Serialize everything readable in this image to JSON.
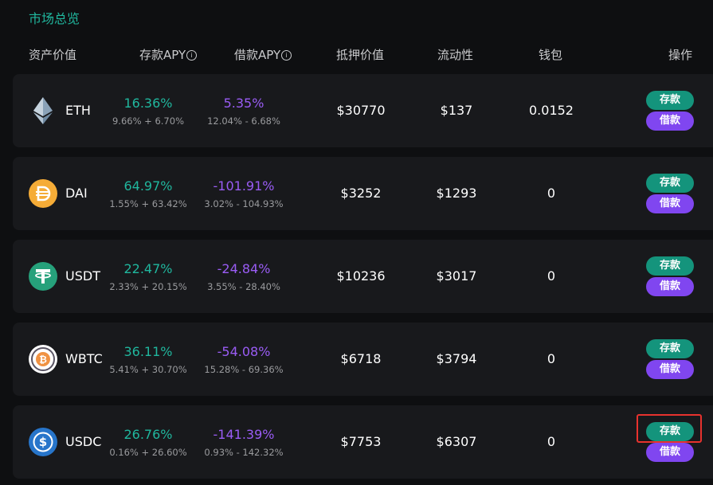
{
  "title": "市场总览",
  "headers": {
    "asset_value": "资产价值",
    "supply_apy": "存款APY",
    "borrow_apy": "借款APY",
    "collateral_value": "抵押价值",
    "liquidity": "流动性",
    "wallet": "钱包",
    "actions": "操作"
  },
  "info_glyph": "i",
  "rows": [
    {
      "name": "ETH",
      "icon": "eth-icon",
      "supply_apy": "16.36%",
      "supply_detail": "9.66% + 6.70%",
      "borrow_apy": "5.35%",
      "borrow_detail": "12.04% - 6.68%",
      "collateral": "$30770",
      "liquidity": "$137",
      "wallet": "0.0152",
      "deposit_label": "存款",
      "borrow_label": "借款"
    },
    {
      "name": "DAI",
      "icon": "dai-icon",
      "supply_apy": "64.97%",
      "supply_detail": "1.55% + 63.42%",
      "borrow_apy": "-101.91%",
      "borrow_detail": "3.02% - 104.93%",
      "collateral": "$3252",
      "liquidity": "$1293",
      "wallet": "0",
      "deposit_label": "存款",
      "borrow_label": "借款"
    },
    {
      "name": "USDT",
      "icon": "usdt-icon",
      "supply_apy": "22.47%",
      "supply_detail": "2.33% + 20.15%",
      "borrow_apy": "-24.84%",
      "borrow_detail": "3.55% - 28.40%",
      "collateral": "$10236",
      "liquidity": "$3017",
      "wallet": "0",
      "deposit_label": "存款",
      "borrow_label": "借款"
    },
    {
      "name": "WBTC",
      "icon": "wbtc-icon",
      "supply_apy": "36.11%",
      "supply_detail": "5.41% + 30.70%",
      "borrow_apy": "-54.08%",
      "borrow_detail": "15.28% - 69.36%",
      "collateral": "$6718",
      "liquidity": "$3794",
      "wallet": "0",
      "deposit_label": "存款",
      "borrow_label": "借款"
    },
    {
      "name": "USDC",
      "icon": "usdc-icon",
      "supply_apy": "26.76%",
      "supply_detail": "0.16% + 26.60%",
      "borrow_apy": "-141.39%",
      "borrow_detail": "0.93% - 142.32%",
      "collateral": "$7753",
      "liquidity": "$6307",
      "wallet": "0",
      "deposit_label": "存款",
      "borrow_label": "借款"
    }
  ],
  "colors": {
    "accent_green": "#20b79e",
    "accent_purple": "#9a5cf5",
    "deposit_button": "#14947c",
    "borrow_button": "#8046f0",
    "highlight_box": "#e8322e"
  }
}
